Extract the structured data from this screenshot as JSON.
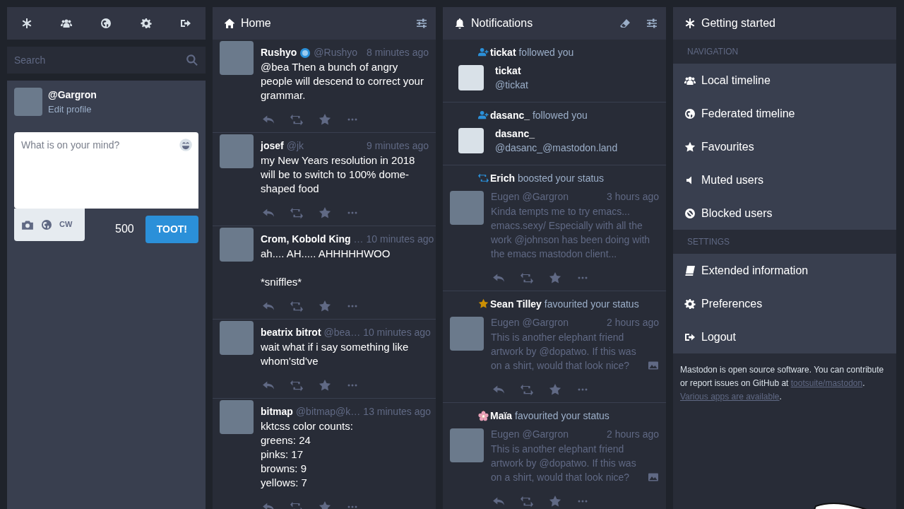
{
  "search": {
    "placeholder": "Search"
  },
  "account": {
    "handle": "@Gargron",
    "edit_link": "Edit profile"
  },
  "compose": {
    "placeholder": "What is on your mind?",
    "cw": "CW",
    "counter": "500",
    "button": "TOOT!"
  },
  "home": {
    "title": "Home",
    "statuses": [
      {
        "name": "Rushyo",
        "verified": true,
        "handle": "@Rushyo",
        "time": "8 minutes ago",
        "text": "@bea Then a bunch of angry people will descend to correct your grammar."
      },
      {
        "name": "josef",
        "verified": false,
        "handle": "@jk",
        "time": "9 minutes ago",
        "text": "my New Years resolution in 2018 will be to switch to 100% dome-shaped food"
      },
      {
        "name": "Crom, Kobold King",
        "verified": false,
        "handle": "…",
        "time": "10 minutes ago",
        "text": "ah.... AH..... AHHHHHWOO\n\n*sniffles*"
      },
      {
        "name": "beatrix bitrot",
        "verified": false,
        "handle": "@bea…",
        "time": "10 minutes ago",
        "text": "wait what if i say something like whom'std've"
      },
      {
        "name": "bitmap",
        "verified": false,
        "handle": "@bitmap@k…",
        "time": "13 minutes ago",
        "text": "kktcss color counts:\ngreens: 24\npinks: 17\nbrowns: 9\nyellows: 7"
      }
    ]
  },
  "notifications": {
    "title": "Notifications",
    "items": [
      {
        "kind": "follow",
        "actor": "tickat",
        "flower_emoji": false,
        "action": "followed you",
        "account": {
          "name": "tickat",
          "handle": "@tickat"
        }
      },
      {
        "kind": "follow",
        "actor": "dasanc_",
        "flower_emoji": false,
        "action": "followed you",
        "account": {
          "name": "dasanc_",
          "handle": "@dasanc_@mastodon.land"
        }
      },
      {
        "kind": "boost",
        "actor": "Erich",
        "flower_emoji": false,
        "action": "boosted your status",
        "status": {
          "name": "Eugen",
          "handle": "@Gargron",
          "time": "3 hours ago",
          "text": "Kinda tempts me to try emacs... emacs.sexy/ Especially with all the work @johnson has been doing with the emacs mastodon client...",
          "media": false
        }
      },
      {
        "kind": "favourite",
        "actor": "Sean Tilley",
        "flower_emoji": false,
        "action": "favourited your status",
        "status": {
          "name": "Eugen",
          "handle": "@Gargron",
          "time": "2 hours ago",
          "text": "This is another elephant friend artwork by @dopatwo. If this was on a shirt, would that look nice?",
          "media": true
        }
      },
      {
        "kind": "favourite",
        "actor": "Maïa",
        "flower_emoji": true,
        "action": "favourited your status",
        "status": {
          "name": "Eugen",
          "handle": "@Gargron",
          "time": "2 hours ago",
          "text": "This is another elephant friend artwork by @dopatwo. If this was on a shirt, would that look nice?",
          "media": true
        }
      }
    ]
  },
  "getting_started": {
    "title": "Getting started",
    "sections": [
      {
        "heading": "NAVIGATION",
        "items": [
          "Local timeline",
          "Federated timeline",
          "Favourites",
          "Muted users",
          "Blocked users"
        ]
      },
      {
        "heading": "SETTINGS",
        "items": [
          "Extended information",
          "Preferences",
          "Logout"
        ]
      }
    ],
    "footer": [
      {
        "kind": "text",
        "text": "Mastodon is open source software. You can contribute or report issues on GitHub at "
      },
      {
        "kind": "link",
        "text": "tootsuite/mastodon"
      },
      {
        "kind": "text",
        "text": ". "
      },
      {
        "kind": "link",
        "text": "Various apps are available"
      },
      {
        "kind": "text",
        "text": "."
      }
    ]
  }
}
